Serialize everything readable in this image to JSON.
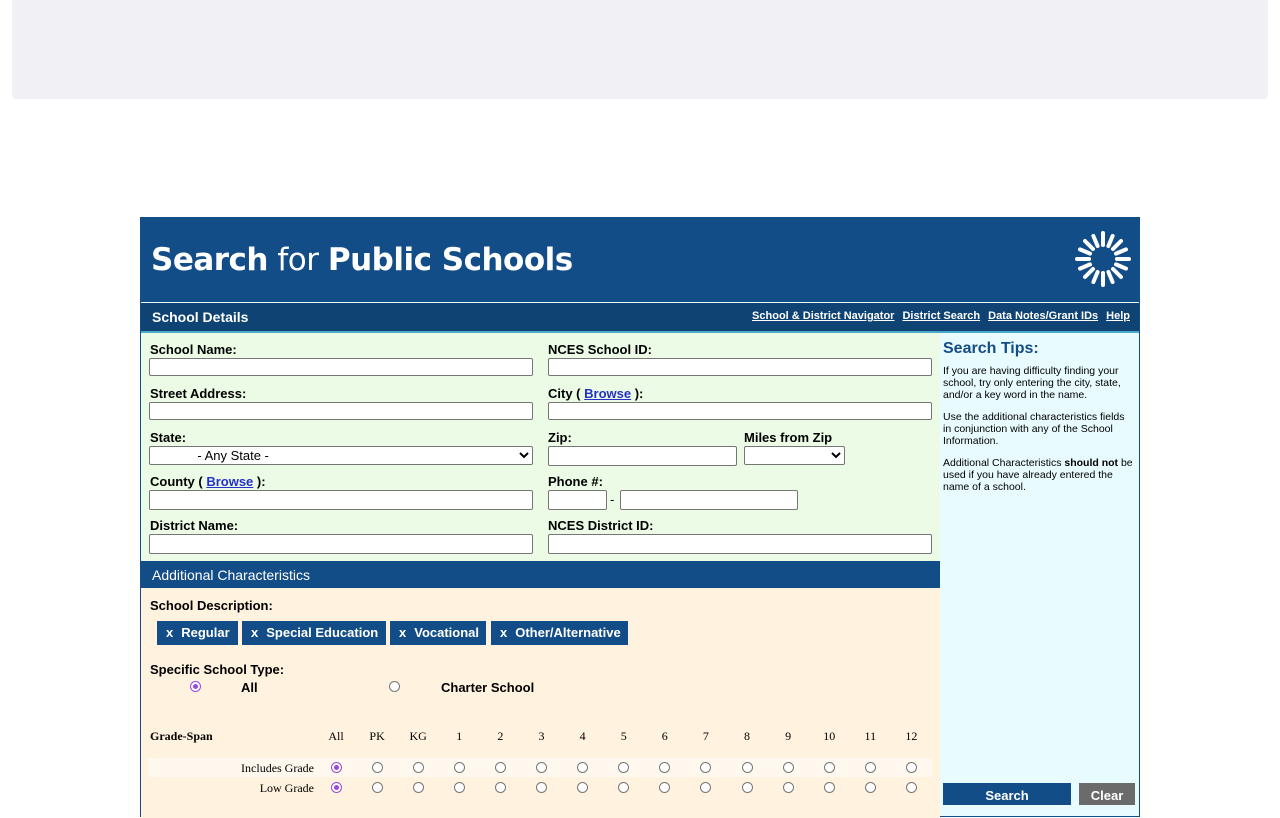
{
  "header": {
    "title_bold_1": "Search",
    "title_light": "for",
    "title_bold_2": "Public Schools"
  },
  "section": {
    "title": "School Details",
    "nav_links": [
      "School & District Navigator",
      "District Search",
      "Data Notes/Grant IDs",
      "Help"
    ]
  },
  "fields": {
    "school_name": {
      "label": "School Name:",
      "value": ""
    },
    "nces_school_id": {
      "label": "NCES School ID:",
      "value": ""
    },
    "street_address": {
      "label": "Street Address:",
      "value": ""
    },
    "city": {
      "label_pre": "City ( ",
      "browse": "Browse",
      "label_post": " ):",
      "value": ""
    },
    "state": {
      "label": "State:",
      "selected": "- Any State -"
    },
    "zip": {
      "label": "Zip:",
      "value": ""
    },
    "miles_from_zip": {
      "label": "Miles from Zip",
      "selected": ""
    },
    "county": {
      "label_pre": "County ( ",
      "browse": "Browse",
      "label_post": " ):",
      "value": ""
    },
    "phone": {
      "label": "Phone #:",
      "area": "",
      "number": "",
      "separator": "-"
    },
    "district_name": {
      "label": "District Name:",
      "value": ""
    },
    "nces_district_id": {
      "label": "NCES District ID:",
      "value": ""
    }
  },
  "tips": {
    "title": "Search Tips:",
    "p1": "If you are having difficulty finding your school, try only entering the city, state, and/or a key word in the name.",
    "p2": "Use the additional characteristics fields in conjunction with any of the School Information.",
    "p3_pre": "Additional Characteristics ",
    "p3_bold": "should not",
    "p3_post": " be used if you have already entered the name of a school."
  },
  "additional": {
    "title": "Additional Characteristics",
    "description_label": "School Description:",
    "chips": [
      {
        "x": "x",
        "label": "Regular"
      },
      {
        "x": "x",
        "label": "Special Education"
      },
      {
        "x": "x",
        "label": "Vocational"
      },
      {
        "x": "x",
        "label": "Other/Alternative"
      }
    ],
    "school_type_label": "Specific School Type:",
    "school_type_options": [
      "All",
      "Charter School"
    ],
    "school_type_selected": "All",
    "grade_span": {
      "title": "Grade-Span",
      "columns": [
        "All",
        "PK",
        "KG",
        "1",
        "2",
        "3",
        "4",
        "5",
        "6",
        "7",
        "8",
        "9",
        "10",
        "11",
        "12"
      ],
      "rows": [
        {
          "label": "Includes Grade",
          "selected": "All"
        },
        {
          "label": "Low Grade",
          "selected": "All"
        }
      ]
    }
  },
  "buttons": {
    "search": "Search",
    "clear": "Clear"
  },
  "colors": {
    "primary": "#134d87",
    "details_bg": "#ebfbe5",
    "tips_bg": "#e8fbff",
    "addl_bg": "#fff2de",
    "radio_accent": "#9b47e0"
  }
}
